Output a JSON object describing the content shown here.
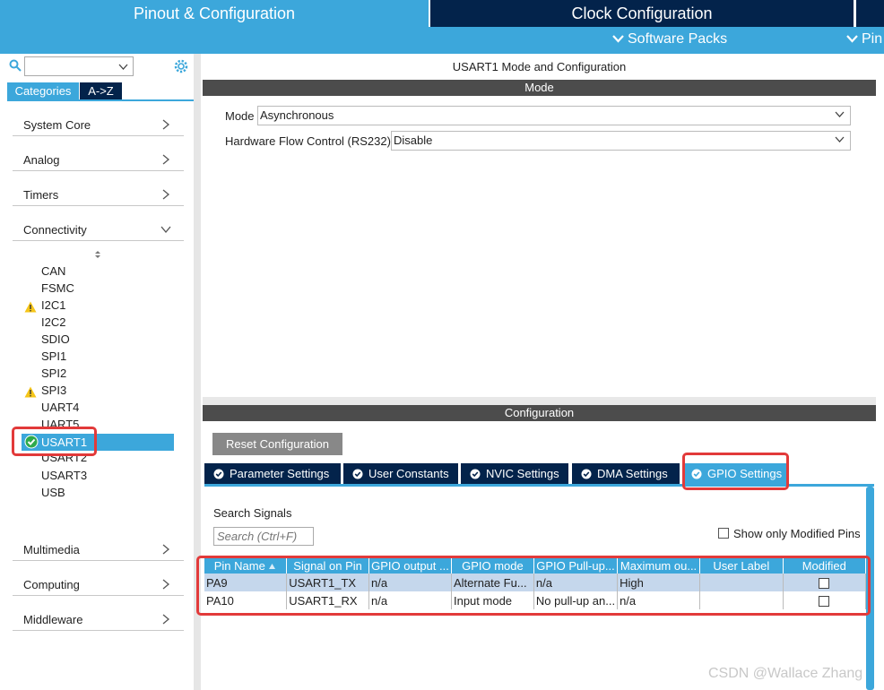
{
  "tabs": {
    "pinout": "Pinout & Configuration",
    "clock": "Clock Configuration"
  },
  "subbar": {
    "software_packs": "Software Packs",
    "pinout": "Pin"
  },
  "left": {
    "view_tabs": [
      "Categories",
      "A->Z"
    ],
    "categories": [
      "System Core",
      "Analog",
      "Timers",
      "Connectivity",
      "Multimedia",
      "Computing",
      "Middleware"
    ],
    "peripherals": [
      "CAN",
      "FSMC",
      "I2C1",
      "I2C2",
      "SDIO",
      "SPI1",
      "SPI2",
      "SPI3",
      "UART4",
      "UART5",
      "USART1",
      "USART2",
      "USART3",
      "USB"
    ]
  },
  "main": {
    "title": "USART1 Mode and Configuration",
    "mode_bar": "Mode",
    "mode_label": "Mode",
    "mode_value": "Asynchronous",
    "flow_label": "Hardware Flow Control (RS232)",
    "flow_value": "Disable",
    "config_bar": "Configuration",
    "reset_button": "Reset Configuration",
    "config_tabs": [
      "Parameter Settings",
      "User Constants",
      "NVIC Settings",
      "DMA Settings",
      "GPIO Settings"
    ],
    "search_label": "Search Signals",
    "search_placeholder": "Search (Ctrl+F)",
    "show_modified": "Show only Modified Pins",
    "table": {
      "headers": [
        "Pin Name",
        "Signal on Pin",
        "GPIO output ...",
        "GPIO mode",
        "GPIO Pull-up...",
        "Maximum ou...",
        "User Label",
        "Modified"
      ],
      "rows": [
        [
          "PA9",
          "USART1_TX",
          "n/a",
          "Alternate Fu...",
          "n/a",
          "High",
          "",
          ""
        ],
        [
          "PA10",
          "USART1_RX",
          "n/a",
          "Input mode",
          "No pull-up an...",
          "n/a",
          "",
          ""
        ]
      ]
    }
  },
  "watermark": "CSDN @Wallace Zhang",
  "colors": {
    "accent": "#3ca7db",
    "dark_navy": "#03234b",
    "highlight_red": "#e23a3a",
    "warning": "#f5c518",
    "ok_green": "#2eaa4b"
  }
}
